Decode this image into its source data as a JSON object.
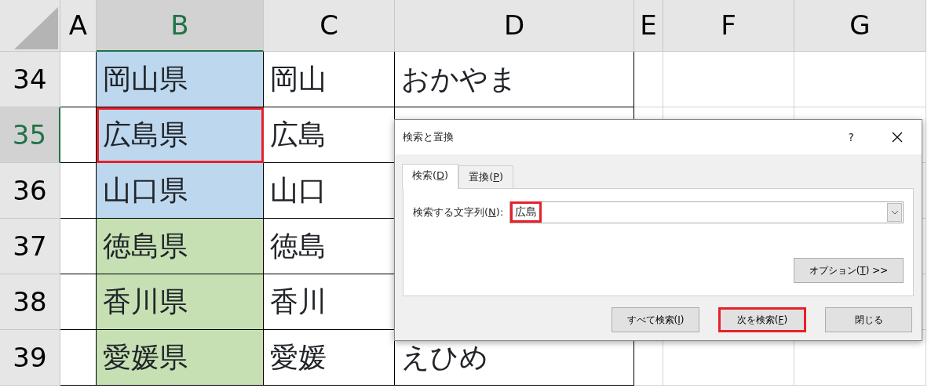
{
  "sheet": {
    "columns": [
      {
        "label": "A",
        "selected": false
      },
      {
        "label": "B",
        "selected": true
      },
      {
        "label": "C",
        "selected": false
      },
      {
        "label": "D",
        "selected": false
      },
      {
        "label": "E",
        "selected": false
      },
      {
        "label": "F",
        "selected": false
      },
      {
        "label": "G",
        "selected": false
      }
    ],
    "rows": [
      {
        "label": "34",
        "selected": false,
        "b": {
          "text": "岡山県",
          "color": "#bdd7ee",
          "active": false
        },
        "c": "岡山",
        "d": "おかやま"
      },
      {
        "label": "35",
        "selected": true,
        "b": {
          "text": "広島県",
          "color": "#bdd7ee",
          "active": true
        },
        "c": "広島"
      },
      {
        "label": "36",
        "selected": false,
        "b": {
          "text": "山口県",
          "color": "#bdd7ee",
          "active": false
        },
        "c": "山口"
      },
      {
        "label": "37",
        "selected": false,
        "b": {
          "text": "徳島県",
          "color": "#c6e0b4",
          "active": false
        },
        "c": "徳島"
      },
      {
        "label": "38",
        "selected": false,
        "b": {
          "text": "香川県",
          "color": "#c6e0b4",
          "active": false
        },
        "c": "香川"
      },
      {
        "label": "39",
        "selected": false,
        "b": {
          "text": "愛媛県",
          "color": "#c6e0b4",
          "active": false
        },
        "c": "愛媛",
        "d": "えひめ"
      }
    ]
  },
  "dialog": {
    "title": "検索と置換",
    "help": "?",
    "tabs": [
      {
        "before": "検索(",
        "key": "D",
        "after": ")",
        "selected": true
      },
      {
        "before": "置換(",
        "key": "P",
        "after": ")",
        "selected": false
      }
    ],
    "field": {
      "before": "検索する文字列(",
      "key": "N",
      "after": "):",
      "value": "広島",
      "highlighted": true
    },
    "options_button": {
      "before": "オプション(",
      "key": "T",
      "after": ") >>"
    },
    "buttons": [
      {
        "before": "すべて検索(",
        "key": "I",
        "after": ")",
        "highlighted": false
      },
      {
        "before": "次を検索(",
        "key": "F",
        "after": ")",
        "highlighted": true
      },
      {
        "before": "閉じる",
        "highlighted": false
      }
    ]
  }
}
